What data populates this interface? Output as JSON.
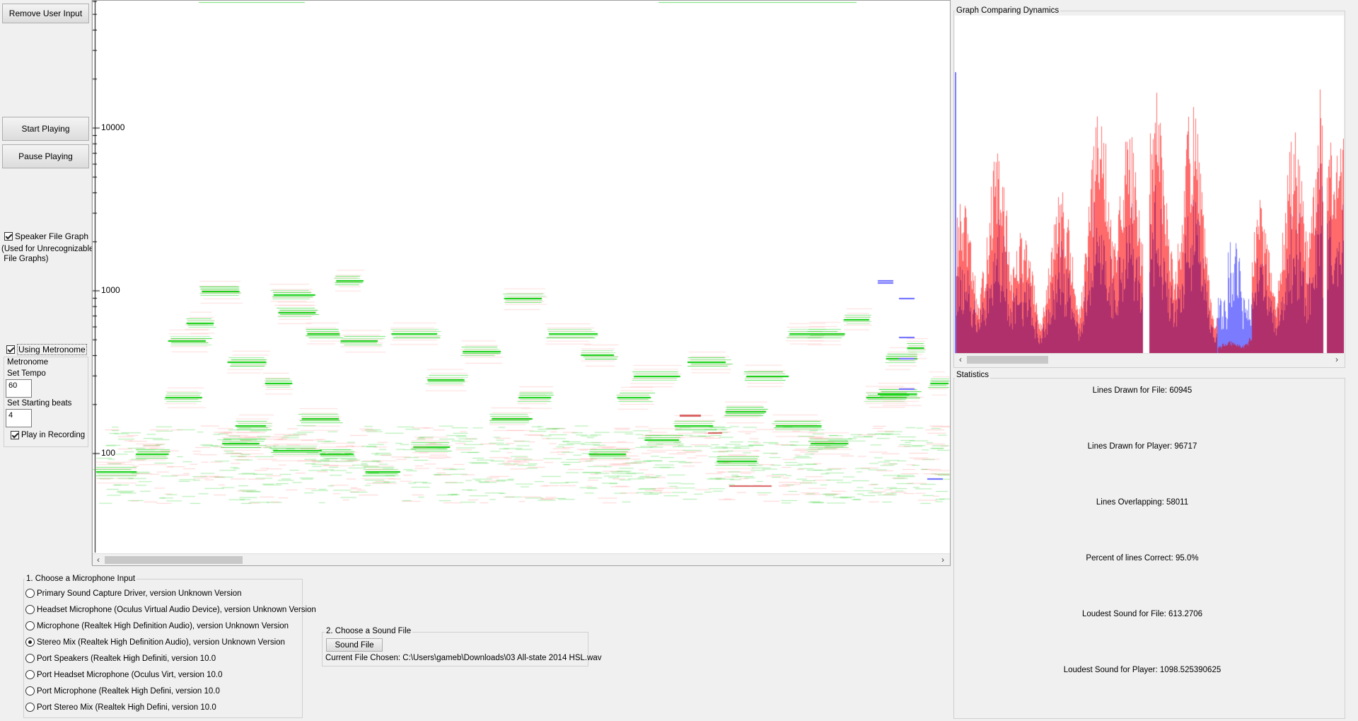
{
  "left_panel": {
    "remove_input_label": "Remove User Input",
    "start_label": "Start Playing",
    "pause_label": "Pause Playing",
    "speaker_graph_label": "Speaker File Graph",
    "speaker_graph_checked": true,
    "speaker_note_line1": "(Used for Unrecognizable",
    "speaker_note_line2": " File Graphs)",
    "metronome_toggle_label": "Using Metronome",
    "metronome_toggle_checked": true,
    "metronome_title": "Metronome",
    "tempo_label": "Set Tempo",
    "tempo_value": "60",
    "beats_label": "Set Starting beats",
    "beats_value": "4",
    "play_in_recording_label": "Play in Recording",
    "play_in_recording_checked": true
  },
  "spectrogram": {
    "axis_labels": [
      "10000",
      "1000",
      "100"
    ],
    "colors": {
      "file": "#00dd00",
      "player": "#ff8080",
      "overlap_player": "#3333ff"
    }
  },
  "dynamics": {
    "title": "Graph Comparing Dynamics",
    "colors": {
      "file": "#ff6b6b",
      "player": "#7b7bff",
      "overlap": "#b0306b"
    }
  },
  "statistics": {
    "title": "Statistics",
    "items": [
      "Lines Drawn for File: 60945",
      "Lines Drawn for Player: 96717",
      "Lines Overlapping: 58011",
      "Percent of lines Correct: 95.0%",
      "Loudest Sound for File: 613.2706",
      "Loudest Sound for Player: 1098.525390625"
    ]
  },
  "microphone": {
    "title": "1. Choose a Microphone Input",
    "selected_index": 3,
    "options": [
      "Primary Sound Capture Driver, version Unknown Version",
      "Headset Microphone (Oculus Virtual Audio Device), version Unknown Version",
      "Microphone (Realtek High Definition Audio), version Unknown Version",
      "Stereo Mix (Realtek High Definition Audio), version Unknown Version",
      "Port Speakers (Realtek High Definiti, version 10.0",
      "Port Headset Microphone (Oculus Virt, version 10.0",
      "Port Microphone (Realtek High Defini, version 10.0",
      "Port Stereo Mix (Realtek High Defini, version 10.0"
    ]
  },
  "sound_file": {
    "title": "2. Choose a Sound File",
    "button_label": "Sound File",
    "current_file": "Current File Chosen: C:\\Users\\gameb\\Downloads\\03 All-state 2014 HSL.wav"
  }
}
